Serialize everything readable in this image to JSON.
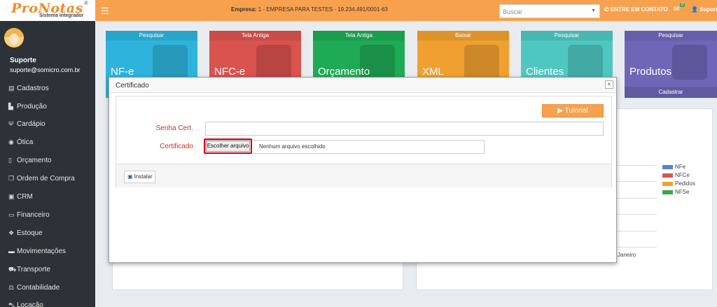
{
  "brand": {
    "name": "ProNotas",
    "reg": "®",
    "subtitle": "Sistema Integrador"
  },
  "header": {
    "empresa_label": "Empresa:",
    "empresa_value": "1 - EMPRESA PARA TESTES - 19.234.491/0001-63",
    "search_placeholder": "Buscar",
    "contact_label": "ENTRE EM CONTATO",
    "mail_badge": "0",
    "user_label": "Suporte"
  },
  "user": {
    "name": "Suporte",
    "email": "suporte@somicro.com.br"
  },
  "sidebar": {
    "items": [
      {
        "label": "Cadastros",
        "icon": "file-icon"
      },
      {
        "label": "Produção",
        "icon": "factory-icon"
      },
      {
        "label": "Cardápio",
        "icon": "cutlery-icon"
      },
      {
        "label": "Ótica",
        "icon": "eye-icon"
      },
      {
        "label": "Orçamento",
        "icon": "file-icon"
      },
      {
        "label": "Ordem de Compra",
        "icon": "copy-icon"
      },
      {
        "label": "CRM",
        "icon": "crm-icon"
      },
      {
        "label": "Financeiro",
        "icon": "money-icon"
      },
      {
        "label": "Estoque",
        "icon": "cubes-icon"
      },
      {
        "label": "Movimentações",
        "icon": "book-icon"
      },
      {
        "label": "Transporte",
        "icon": "truck-icon"
      },
      {
        "label": "Contabilidade",
        "icon": "balance-icon"
      },
      {
        "label": "Locação",
        "icon": "car-icon"
      }
    ]
  },
  "tiles": [
    {
      "head": "Pesquisar",
      "title": "NF-e",
      "color": "#2eb4dc",
      "foot": ""
    },
    {
      "head": "Tela Antiga",
      "title": "NFC-e",
      "color": "#d9534f",
      "foot": ""
    },
    {
      "head": "Tela Antiga",
      "title": "Orçamento",
      "color": "#1faa55",
      "foot": ""
    },
    {
      "head": "Baixar",
      "title": "XML",
      "color": "#f0a030",
      "foot": ""
    },
    {
      "head": "Pesquisar",
      "title": "Clientes",
      "color": "#4fc7c1",
      "foot": ""
    },
    {
      "head": "Pesquisar",
      "title": "Produtos",
      "color": "#6e67b8",
      "foot": "Cadastrar"
    }
  ],
  "chart_legend": [
    {
      "label": "NFe",
      "color": "#5b7fd6"
    },
    {
      "label": "NFCe",
      "color": "#d9534f"
    },
    {
      "label": "Pedidos",
      "color": "#f0a030"
    },
    {
      "label": "NFSe",
      "color": "#3aa64a"
    }
  ],
  "chart_axis_label": "Janeiro",
  "modal": {
    "title": "Certificado",
    "close_label": "×",
    "tutorial_label": "Tutorial",
    "senha_label": "Senha Cert.",
    "senha_value": "",
    "certificado_label": "Certificado",
    "file_button_label": "Escolher arquivo",
    "file_status": "Nenhum arquivo escolhido",
    "install_label": "Instalar"
  },
  "colors": {
    "accent": "#f7a14e",
    "sidebar": "#2d3238",
    "label_red": "#c4302b",
    "highlight": "#d0021b"
  }
}
